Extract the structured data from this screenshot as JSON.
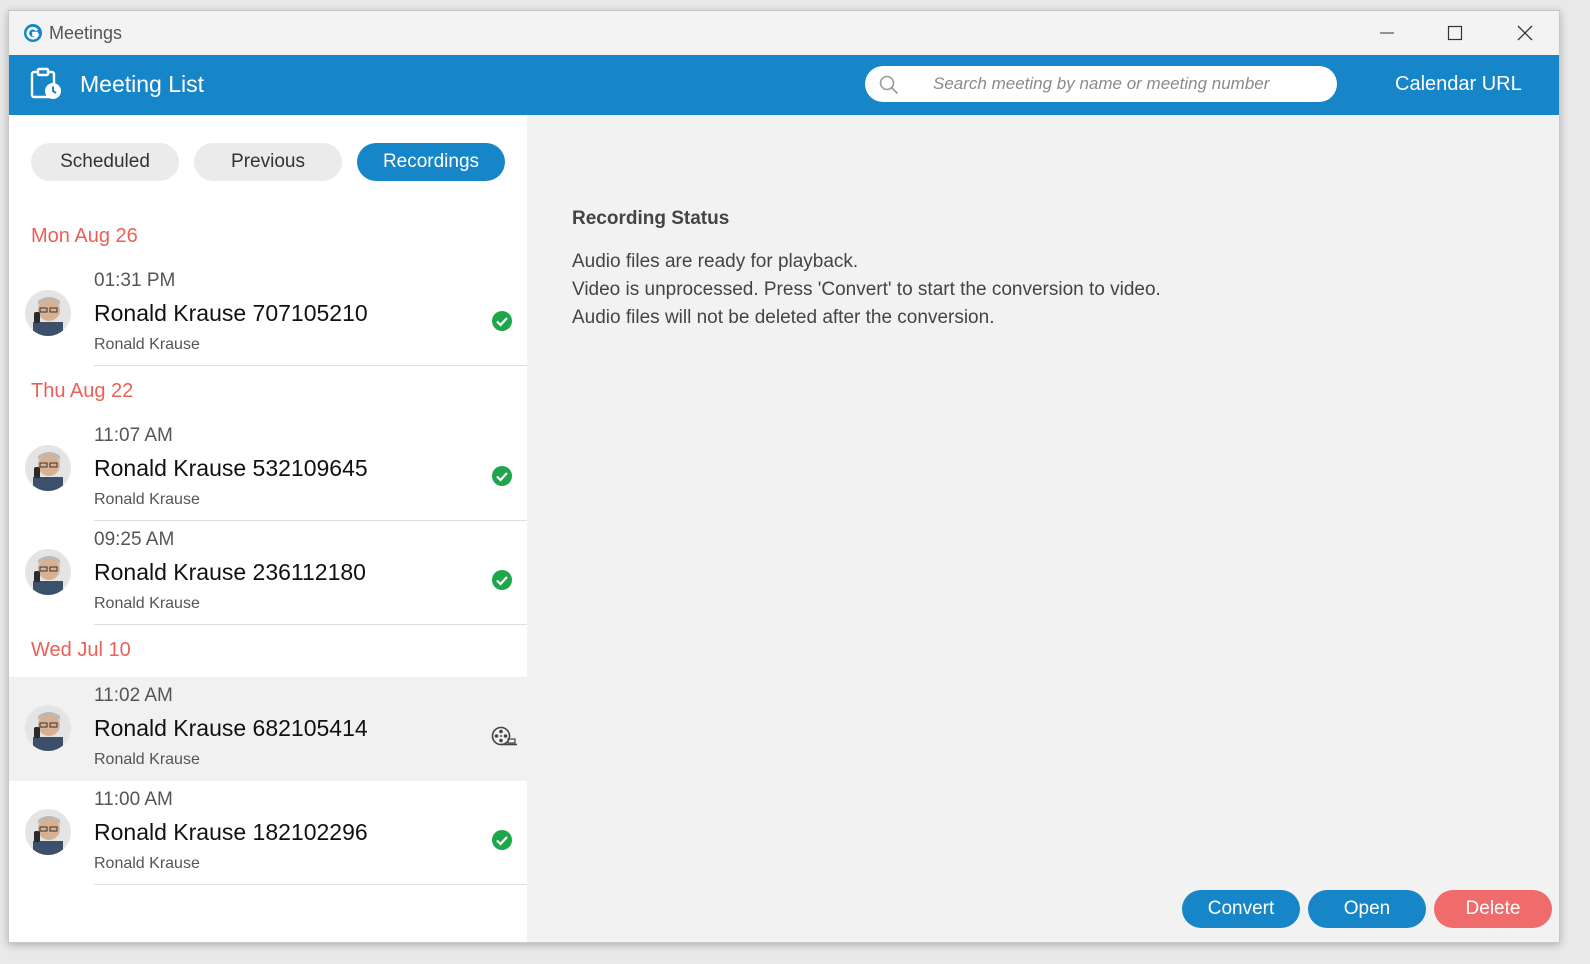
{
  "window": {
    "title": "Meetings"
  },
  "header": {
    "title": "Meeting List",
    "search_placeholder": "Search meeting by name or meeting number",
    "calendar_url_label": "Calendar URL"
  },
  "tabs": [
    {
      "label": "Scheduled",
      "active": false
    },
    {
      "label": "Previous",
      "active": false
    },
    {
      "label": "Recordings",
      "active": true
    }
  ],
  "groups": [
    {
      "date": "Mon Aug 26",
      "items": [
        {
          "time": "01:31 PM",
          "name": "Ronald Krause 707105210",
          "host": "Ronald Krause",
          "status_icon": "check-circle-icon"
        }
      ]
    },
    {
      "date": "Thu Aug 22",
      "items": [
        {
          "time": "11:07 AM",
          "name": "Ronald Krause 532109645",
          "host": "Ronald Krause",
          "status_icon": "check-circle-icon"
        },
        {
          "time": "09:25 AM",
          "name": "Ronald Krause 236112180",
          "host": "Ronald Krause",
          "status_icon": "check-circle-icon"
        }
      ]
    },
    {
      "date": "Wed Jul 10",
      "items": [
        {
          "time": "11:02 AM",
          "name": "Ronald Krause 682105414",
          "host": "Ronald Krause",
          "status_icon": "film-reel-icon",
          "selected": true
        },
        {
          "time": "11:00 AM",
          "name": "Ronald Krause 182102296",
          "host": "Ronald Krause",
          "status_icon": "check-circle-icon"
        }
      ]
    }
  ],
  "recording_status": {
    "title": "Recording Status",
    "lines": [
      "Audio files are ready for playback.",
      "Video is unprocessed. Press 'Convert' to start the conversion to video.",
      "Audio files will not be deleted after the conversion."
    ]
  },
  "actions": {
    "convert": "Convert",
    "open": "Open",
    "delete": "Delete"
  },
  "colors": {
    "accent": "#1686c8",
    "date_header": "#ec5f57",
    "delete_button": "#f06b6b",
    "success": "#1ea64a"
  }
}
